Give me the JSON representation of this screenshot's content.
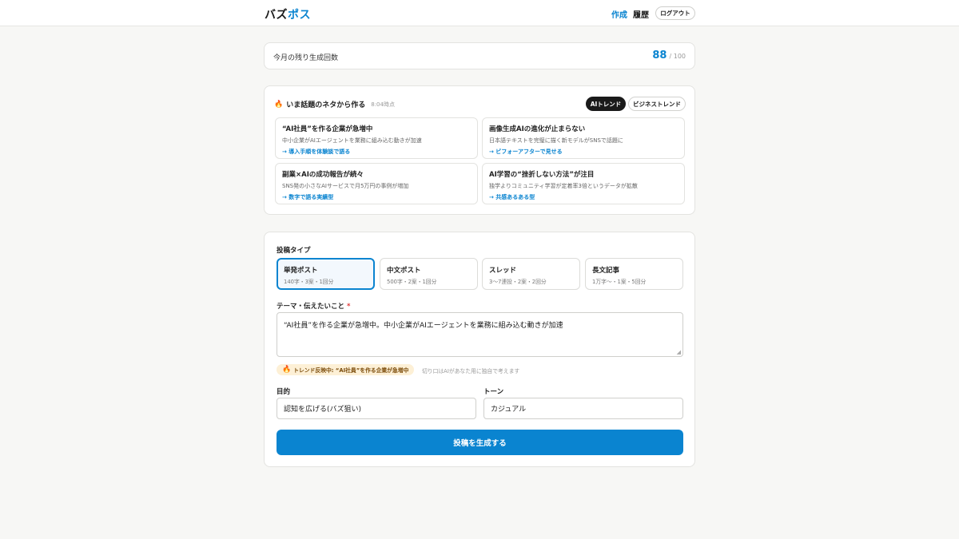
{
  "header": {
    "logo_part1": "バズ",
    "logo_part2": "ポス",
    "nav_create": "作成",
    "nav_history": "履歴",
    "logout": "ログアウト"
  },
  "usage": {
    "label": "今月の残り生成回数",
    "remaining": "88",
    "max": "/ 100"
  },
  "trends": {
    "icon": "fire-icon",
    "title": "いま話題のネタから作る",
    "time": "8:04時点",
    "tabs": [
      "AIトレンド",
      "ビジネストレンド"
    ],
    "items": [
      {
        "title": "“AI社員”を作る企業が急増中",
        "desc": "中小企業がAIエージェントを業務に組み込む動きが加速",
        "angle": "→ 導入手順を体験談で語る"
      },
      {
        "title": "画像生成AIの進化が止まらない",
        "desc": "日本語テキストを完璧に描く新モデルがSNSで話題に",
        "angle": "→ ビフォーアフターで見せる"
      },
      {
        "title": "副業×AIの成功報告が続々",
        "desc": "SNS発の小さなAIサービスで月5万円の事例が増加",
        "angle": "→ 数字で語る実績型"
      },
      {
        "title": "AI学習の“挫折しない方法”が注目",
        "desc": "独学よりコミュニティ学習が定着率3倍というデータが拡散",
        "angle": "→ 共感あるある型"
      }
    ]
  },
  "form": {
    "post_type_label": "投稿タイプ",
    "post_types": [
      {
        "name": "単発ポスト",
        "detail": "140字・3案・1回分"
      },
      {
        "name": "中文ポスト",
        "detail": "500字・2案・1回分"
      },
      {
        "name": "スレッド",
        "detail": "3〜7連投・2案・2回分"
      },
      {
        "name": "長文記事",
        "detail": "1万字〜・1案・5回分"
      }
    ],
    "theme_label": "テーマ・伝えたいこと",
    "required_mark": "*",
    "theme_value": "“AI社員”を作る企業が急増中。中小企業がAIエージェントを業務に組み込む動きが加速",
    "trend_badge": "トレンド反映中: “AI社員”を作る企業が急増中",
    "trend_note": "切り口はAIがあなた用に独自で考えます",
    "purpose_label": "目的",
    "purpose_value": "認知を広げる(バズ狙い)",
    "tone_label": "トーン",
    "tone_value": "カジュアル",
    "submit": "投稿を生成する"
  },
  "colors": {
    "accent": "#0a84d0",
    "background": "#f7f7f5"
  }
}
